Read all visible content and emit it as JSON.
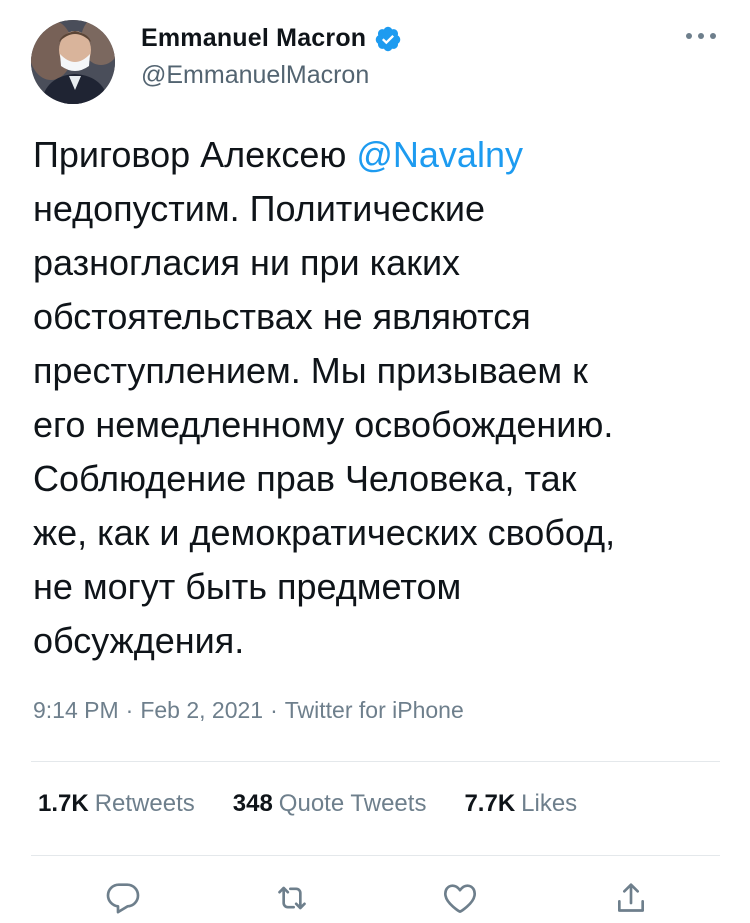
{
  "author": {
    "display_name": "Emmanuel Macron",
    "handle": "@EmmanuelMacron",
    "verified": true
  },
  "tweet": {
    "text_before_mention": "Приговор Алексею ",
    "mention": "@Navalny",
    "text_after_mention": "\nнедопустим. Политические\nразногласия ни при каких\nобстоятельствах не являются\nпреступлением. Мы призываем к\nего немедленному освобождению.\nСоблюдение прав Человека, так\nже, как и демократических свобод,\nне могут быть предметом\nобсуждения."
  },
  "meta": {
    "time": "9:14 PM",
    "separator": "·",
    "date": "Feb 2, 2021",
    "source": "Twitter for iPhone"
  },
  "stats": {
    "retweets_count": "1.7K",
    "retweets_label": "Retweets",
    "quotes_count": "348",
    "quotes_label": "Quote Tweets",
    "likes_count": "7.7K",
    "likes_label": "Likes"
  },
  "colors": {
    "accent": "#1d9bf0",
    "text": "#0f1419",
    "secondary": "#6e7f8c",
    "divider": "#e4e8eb"
  },
  "icons": {
    "more": "more-horizontal-icon",
    "verified": "verified-badge-icon",
    "reply": "reply-bubble-icon",
    "retweet": "retweet-icon",
    "like": "heart-icon",
    "share": "share-icon"
  }
}
